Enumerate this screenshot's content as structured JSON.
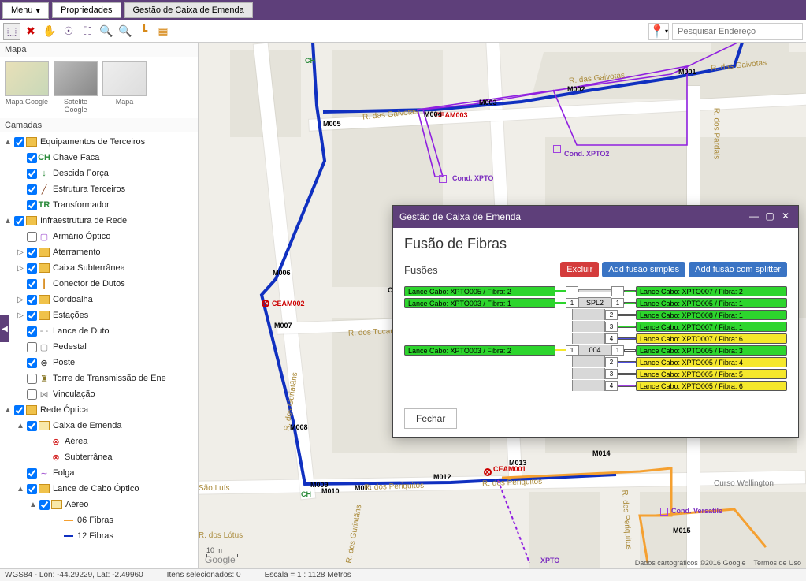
{
  "topbar": {
    "menu": "Menu",
    "props": "Propriedades",
    "splice": "Gestão de Caixa de Emenda"
  },
  "toolbar": {
    "searchPlaceholder": "Pesquisar Endereço"
  },
  "sidebar": {
    "mapTitle": "Mapa",
    "basemaps": [
      {
        "label": "Mapa Google"
      },
      {
        "label": "Satelite Google"
      },
      {
        "label": "Mapa"
      }
    ],
    "layersTitle": "Camadas",
    "tree": [
      {
        "level": 0,
        "tw": "▲",
        "checked": true,
        "icon": "folder",
        "label": "Equipamentos de Terceiros"
      },
      {
        "level": 1,
        "tw": "",
        "checked": true,
        "icon": "ch",
        "label": "Chave Faca"
      },
      {
        "level": 1,
        "tw": "",
        "checked": true,
        "icon": "down-green",
        "label": "Descida Força"
      },
      {
        "level": 1,
        "tw": "",
        "checked": true,
        "icon": "slash",
        "label": "Estrutura Terceiros"
      },
      {
        "level": 1,
        "tw": "",
        "checked": true,
        "icon": "tr",
        "label": "Transformador"
      },
      {
        "level": 0,
        "tw": "▲",
        "checked": true,
        "icon": "folder",
        "label": "Infraestrutura de Rede"
      },
      {
        "level": 1,
        "tw": "",
        "checked": false,
        "icon": "sq-purple",
        "label": "Armário Óptico"
      },
      {
        "level": 1,
        "tw": "▷",
        "checked": true,
        "icon": "folder",
        "label": "Aterramento"
      },
      {
        "level": 1,
        "tw": "▷",
        "checked": true,
        "icon": "folder",
        "label": "Caixa Subterrânea"
      },
      {
        "level": 1,
        "tw": "",
        "checked": true,
        "icon": "pipe",
        "label": "Conector de Dutos"
      },
      {
        "level": 1,
        "tw": "▷",
        "checked": true,
        "icon": "folder",
        "label": "Cordoalha"
      },
      {
        "level": 1,
        "tw": "▷",
        "checked": true,
        "icon": "folder",
        "label": "Estações"
      },
      {
        "level": 1,
        "tw": "",
        "checked": true,
        "icon": "dash",
        "label": "Lance de Duto"
      },
      {
        "level": 1,
        "tw": "",
        "checked": false,
        "icon": "sq-grey",
        "label": "Pedestal"
      },
      {
        "level": 1,
        "tw": "",
        "checked": true,
        "icon": "circle-x",
        "label": "Poste"
      },
      {
        "level": 1,
        "tw": "",
        "checked": false,
        "icon": "tower",
        "label": "Torre de Transmissão de Ene"
      },
      {
        "level": 1,
        "tw": "",
        "checked": false,
        "icon": "vinc",
        "label": "Vinculação"
      },
      {
        "level": 0,
        "tw": "▲",
        "checked": true,
        "icon": "folder",
        "label": "Rede Óptica"
      },
      {
        "level": 1,
        "tw": "▲",
        "checked": true,
        "icon": "folder-o",
        "label": "Caixa de Emenda"
      },
      {
        "level": 2,
        "tw": "",
        "checked": null,
        "icon": "aer",
        "label": "Aérea"
      },
      {
        "level": 2,
        "tw": "",
        "checked": null,
        "icon": "sub",
        "label": "Subterrânea"
      },
      {
        "level": 1,
        "tw": "",
        "checked": true,
        "icon": "tilde",
        "label": "Folga"
      },
      {
        "level": 1,
        "tw": "▲",
        "checked": true,
        "icon": "folder",
        "label": "Lance de Cabo Óptico"
      },
      {
        "level": 2,
        "tw": "▲",
        "checked": true,
        "icon": "folder-o",
        "label": "Aéreo"
      },
      {
        "level": 3,
        "tw": "",
        "checked": null,
        "icon": "line-orange",
        "label": "06 Fibras"
      },
      {
        "level": 3,
        "tw": "",
        "checked": null,
        "icon": "line-blue",
        "label": "12 Fibras"
      }
    ]
  },
  "map": {
    "streets": [
      "R. das Gaivotas",
      "R. das Gaivotas",
      "R. dos Tucanos",
      "R. dos Periquitos",
      "R. dos Periquitos",
      "R. dos Pardais",
      "R. dos Guriatãns",
      "R. dos Guriatãns",
      "São Luís",
      "R. dos Lótus",
      "R. dos Periquitos"
    ],
    "pois": [
      "Curso Wellington"
    ],
    "nodes": [
      "CEAM003",
      "CEAM002",
      "CEAM001",
      "XPTO",
      "Cond. XPTO",
      "Cond. XPTO2",
      "Cond. Versatile",
      "M001",
      "M002",
      "M003",
      "M004",
      "M005",
      "M006",
      "M007",
      "M008",
      "M009",
      "M010",
      "M011",
      "M012",
      "M013",
      "M014",
      "M015",
      "CH",
      "CH",
      "CCA"
    ],
    "scaleLabel": "10 m",
    "google": "Google",
    "attr1": "Dados cartográficos ©2016 Google",
    "attr2": "Termos de Uso"
  },
  "dialog": {
    "title": "Gestão de Caixa de Emenda",
    "subtitle": "Fusão de Fibras",
    "sectionTitle": "Fusões",
    "buttons": {
      "del": "Excluir",
      "simple": "Add fusão simples",
      "split": "Add fusão com splitter"
    },
    "close": "Fechar",
    "splitters": [
      "SPL2",
      "004"
    ],
    "rows": [
      {
        "left": {
          "cls": "cable-green",
          "txt": "Lance Cabo: XPTO005 / Fibra: 2"
        },
        "wireL": "#2dd52d",
        "midPort": "",
        "splNew": true,
        "port": "",
        "wireR": "#2dd52d",
        "right": {
          "cls": "cable-green",
          "txt": "Lance Cabo: XPTO007 / Fibra: 2"
        }
      },
      {
        "left": {
          "cls": "cable-green",
          "txt": "Lance Cabo: XPTO003 / Fibra: 1"
        },
        "wireL": "#2dd52d",
        "midPort": "1",
        "spl": "SPL2",
        "port": "1",
        "wireR": "#2dd52d",
        "right": {
          "cls": "cable-green",
          "txt": "Lance Cabo: XPTO005 / Fibra: 1"
        }
      },
      {
        "left": null,
        "port": "2",
        "wireR": "#f5e82c",
        "right": {
          "cls": "cable-green",
          "txt": "Lance Cabo: XPTO008 / Fibra: 1"
        }
      },
      {
        "left": null,
        "port": "3",
        "wireR": "#2dd52d",
        "right": {
          "cls": "cable-green",
          "txt": "Lance Cabo: XPTO007 / Fibra: 1"
        }
      },
      {
        "left": null,
        "port": "4",
        "wireR": "#5050e0",
        "right": {
          "cls": "cable-yellow",
          "txt": "Lance Cabo: XPTO007 / Fibra: 6"
        }
      },
      {
        "left": {
          "cls": "cable-green",
          "txt": "Lance Cabo: XPTO003 / Fibra: 2"
        },
        "wireL": "#f5e82c",
        "midPort": "1",
        "spl": "004",
        "port": "1",
        "wireR": "#fff",
        "right": {
          "cls": "cable-green",
          "txt": "Lance Cabo: XPTO005 / Fibra: 3"
        }
      },
      {
        "left": null,
        "port": "2",
        "wireR": "#5050e0",
        "right": {
          "cls": "cable-yellow",
          "txt": "Lance Cabo: XPTO005 / Fibra: 4"
        }
      },
      {
        "left": null,
        "port": "3",
        "wireR": "#a33",
        "right": {
          "cls": "cable-yellow",
          "txt": "Lance Cabo: XPTO005 / Fibra: 5"
        }
      },
      {
        "left": null,
        "port": "4",
        "wireR": "#a040e0",
        "right": {
          "cls": "cable-yellow",
          "txt": "Lance Cabo: XPTO005 / Fibra: 6"
        }
      }
    ]
  },
  "status": {
    "coord": "WGS84 - Lon: -44.29229, Lat: -2.49960",
    "sel": "Itens selecionados: 0",
    "scale": "Escala = 1 : 1128 Metros"
  }
}
